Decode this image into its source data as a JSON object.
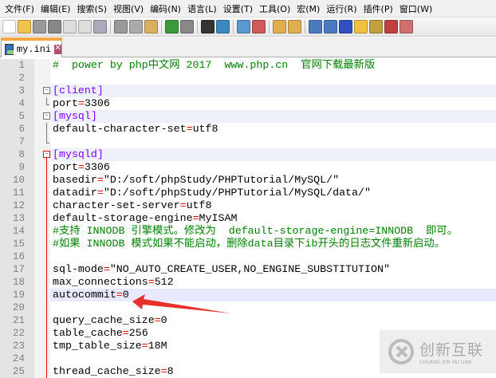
{
  "menu": [
    "文件(F)",
    "编辑(E)",
    "搜索(S)",
    "视图(V)",
    "编码(N)",
    "语言(L)",
    "设置(T)",
    "工具(O)",
    "宏(M)",
    "运行(R)",
    "插件(P)",
    "窗口(W)"
  ],
  "tab": {
    "label": "my.ini"
  },
  "lines": [
    [
      [
        "c",
        "#  power by php中文网 2017  www.php.cn  官网下载最新版"
      ]
    ],
    [],
    [
      [
        "s",
        "[client]"
      ]
    ],
    [
      [
        "k",
        "port"
      ],
      [
        "e",
        "="
      ],
      [
        "k",
        "3306"
      ]
    ],
    [
      [
        "s",
        "[mysql]"
      ]
    ],
    [
      [
        "k",
        "default-character-set"
      ],
      [
        "e",
        "="
      ],
      [
        "k",
        "utf8"
      ]
    ],
    [],
    [
      [
        "s",
        "[mysqld]"
      ]
    ],
    [
      [
        "k",
        "port"
      ],
      [
        "e",
        "="
      ],
      [
        "k",
        "3306"
      ]
    ],
    [
      [
        "k",
        "basedir"
      ],
      [
        "e",
        "="
      ],
      [
        "k",
        "\"D:/soft/phpStudy/PHPTutorial/MySQL/\""
      ]
    ],
    [
      [
        "k",
        "datadir"
      ],
      [
        "e",
        "="
      ],
      [
        "k",
        "\"D:/soft/phpStudy/PHPTutorial/MySQL/data/\""
      ]
    ],
    [
      [
        "k",
        "character-set-server"
      ],
      [
        "e",
        "="
      ],
      [
        "k",
        "utf8"
      ]
    ],
    [
      [
        "k",
        "default-storage-engine"
      ],
      [
        "e",
        "="
      ],
      [
        "k",
        "MyISAM"
      ]
    ],
    [
      [
        "c",
        "#支持 INNODB 引擎模式。修改为  default-storage-engine=INNODB  即可。"
      ]
    ],
    [
      [
        "c",
        "#如果 INNODB 模式如果不能启动，删除data目录下ib开头的日志文件重新启动。"
      ]
    ],
    [],
    [
      [
        "k",
        "sql-mode"
      ],
      [
        "e",
        "="
      ],
      [
        "k",
        "\"NO_AUTO_CREATE_USER,NO_ENGINE_SUBSTITUTION\""
      ]
    ],
    [
      [
        "k",
        "max_connections"
      ],
      [
        "e",
        "="
      ],
      [
        "k",
        "512"
      ]
    ],
    [
      [
        "k",
        "autocommit"
      ],
      [
        "e",
        "="
      ],
      [
        "k",
        "0"
      ]
    ],
    [],
    [
      [
        "k",
        "query_cache_size"
      ],
      [
        "e",
        "="
      ],
      [
        "k",
        "0"
      ]
    ],
    [
      [
        "k",
        "table_cache"
      ],
      [
        "e",
        "="
      ],
      [
        "k",
        "256"
      ]
    ],
    [
      [
        "k",
        "tmp_table_size"
      ],
      [
        "e",
        "="
      ],
      [
        "k",
        "18M"
      ]
    ],
    [],
    [
      [
        "k",
        "thread_cache_size"
      ],
      [
        "e",
        "="
      ],
      [
        "k",
        "8"
      ]
    ]
  ],
  "watermark": {
    "cn": "创新互联",
    "en": "CHUANG XIN HU LIAN"
  }
}
